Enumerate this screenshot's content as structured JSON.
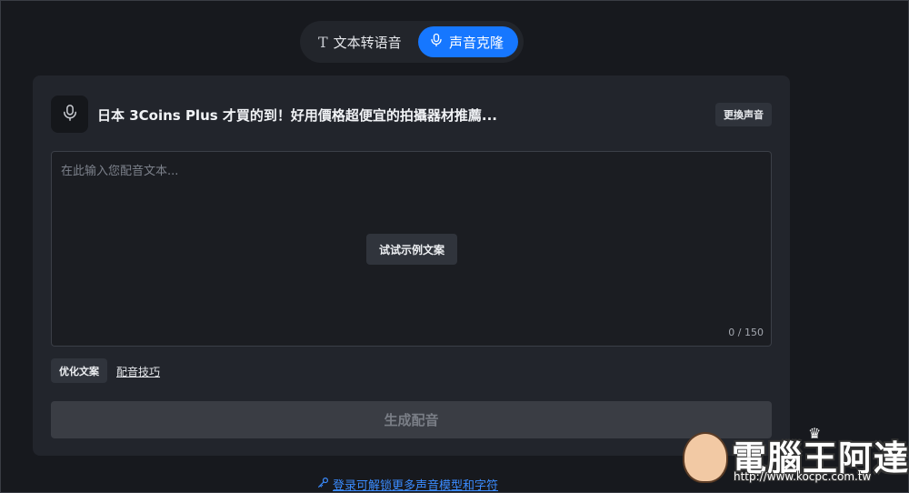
{
  "mode_toggle": {
    "tts_label": "文本转语音",
    "clone_label": "声音克隆",
    "active": "clone",
    "accent_color": "#1677ff"
  },
  "voice": {
    "icon": "microphone-icon",
    "title": "日本 3Coins Plus 才買的到！好用價格超便宜的拍攝器材推薦...",
    "change_button": "更換声音"
  },
  "editor": {
    "placeholder": "在此输入您配音文本...",
    "value": "",
    "sample_button": "试试示例文案",
    "char_count": "0 / 150"
  },
  "actions": {
    "optimize_button": "优化文案",
    "tips_link": "配音技巧",
    "generate_button": "生成配音"
  },
  "login": {
    "icon": "key-icon",
    "text": "登录可解锁更多声音模型和字符"
  },
  "watermark": {
    "title": "電腦王阿達",
    "url": "http://www.kocpc.com.tw"
  }
}
